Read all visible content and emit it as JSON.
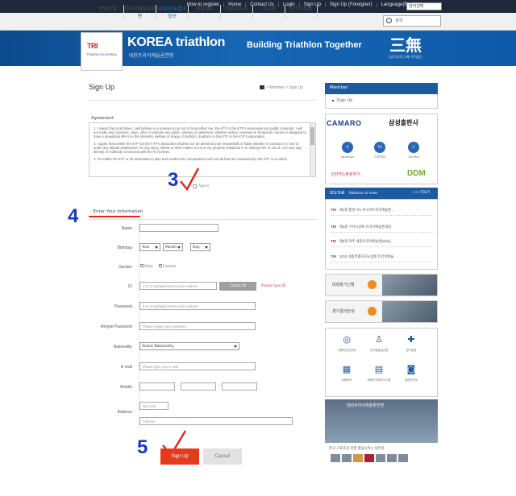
{
  "topbar": {
    "links": [
      "How to register",
      "Home",
      "Contact Us",
      "Login",
      "Sign Up",
      "Sign Up (Foreigner)",
      "Language(English)"
    ],
    "language_select": "언어선택"
  },
  "nav": {
    "items": [
      "연맹소개",
      "트라이애슬론이란",
      "대회안내/결과정보",
      "생활체육",
      "심판/지도자",
      "게시판",
      "선수단정보"
    ],
    "search_placeholder": "검색"
  },
  "banner": {
    "logo_mark": "TRI",
    "logo_sub": "TRIATHLON KOREA",
    "brand": "KOREA triathlon",
    "brand_sub": "대한트라이애슬론연맹",
    "tagline": "Building Triathlon Together",
    "seal": "三無",
    "seal_sub": "(삼무)부정,부패,폭력없는"
  },
  "page": {
    "title": "Sign Up",
    "breadcrumb": "> Member > Sign Up"
  },
  "agreement": {
    "title": "· Agreement",
    "paragraphs": [
      "1. I swear that at all times, I will behave in a manner so as not to bring either me, the KTF or the KTF's associates into public contempt. I will not make any comment, claim, offer or endorse any public criticism or statement, whether written, televised or broadcast, herein or designed to have a prejudicial effect on the interests, welfare or image of triathlon, duathlon or the KTF or the KTF's associates.",
      "2. I agree that neither the KTF nor the KTF's associates shall be nor be deemed to be responsible or liable whether in contract or in tort or under any statute whatsoever, for any injury, illness or other matter to me or my property sustained in or arising from or out of, or in any way directly or indirectly connected with the ITU Events.",
      "3. To enable the KTF or its associates to plan and conduct the competitions and events that are conducted by the KTF or to which"
    ],
    "agree_label": "Agree"
  },
  "annotations": {
    "step3": "3",
    "step4": "4",
    "step5": "5"
  },
  "form": {
    "section_title": "· Enter Your Information",
    "name_label": "Name",
    "birthday_label": "Birthday",
    "year": "Year",
    "month": "Month",
    "day": "Day",
    "gender_label": "Gender",
    "male": "Male",
    "female": "Female",
    "id_label": "ID",
    "id_placeholder": "4 to 12 alphabet letters and numbers.",
    "check_id": "Check ID",
    "id_hint": "Please type ID",
    "password_label": "Password",
    "password_placeholder": "8 to 16 alphabet letters and numbers",
    "retype_label": "Retype Password",
    "retype_placeholder": "Please retype your password",
    "nationality_label": "Nationality",
    "nationality_value": "Select Nationality",
    "email_label": "E-mail",
    "email_placeholder": "Please type your E-mail",
    "mobile_label": "Mobile",
    "address_label": "Address",
    "zip_placeholder": "Zip code",
    "address_placeholder": "Address",
    "dash": "-",
    "signup_button": "Sign Up",
    "cancel_button": "Cancel"
  },
  "sidebar": {
    "member_title": "Member",
    "member_item": "Sign Up",
    "sponsor1": "CAMARO",
    "sponsor2": "삼성출판사",
    "sponsor_icons": [
      "A",
      "TO",
      "C"
    ],
    "sponsor_labels": [
      "Aquaman",
      "TOPTEN",
      "Cervelo"
    ],
    "sponsor3": "신한카드후원하기",
    "sponsor4": "DDM",
    "news_title": "보도자료",
    "news_sub": "Relations of news",
    "news_more": ">> 더보기",
    "news_items": [
      "제1회 통영 ITU 아시아트라이애슬론...",
      "제4회 구미시장배 트라이애슬론대회",
      "제5회 여주 세종트라이애슬론[Kids]...",
      "2015 세종특별자치시장배 트라이애슬..."
    ],
    "banner1": "대회참가신청",
    "banner2": "경기결과안내",
    "quick_labels": [
      "이용자유권안내",
      "선수증발급신청",
      "경기일정",
      "대회정보",
      "체육인식정보시스템",
      "훈련장안내"
    ],
    "photo_caption": "대한트라이애슬론연맹",
    "photo_text": "한국 스포츠의 인권 향상시키는 동반자"
  }
}
